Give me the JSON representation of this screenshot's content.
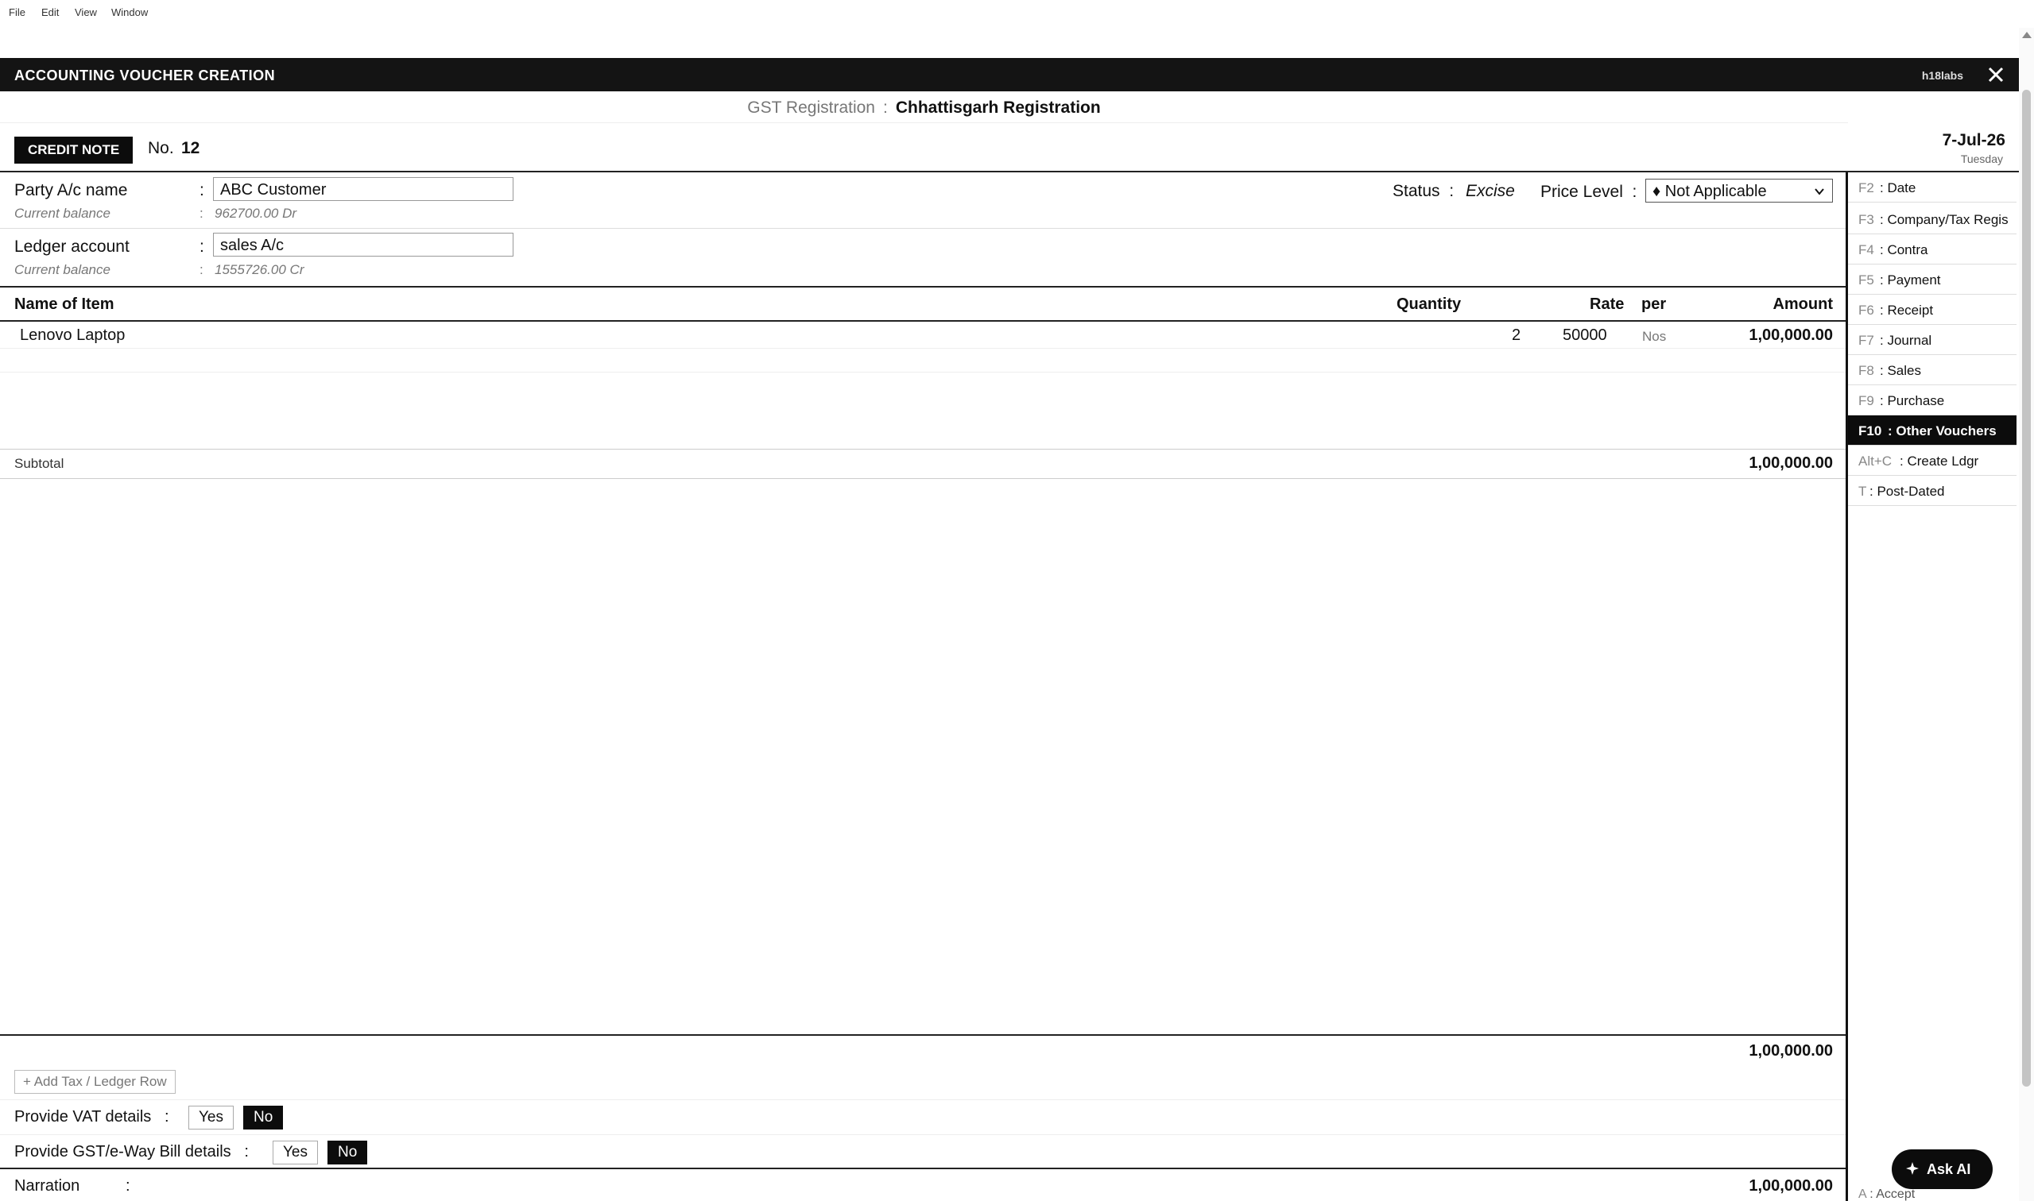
{
  "menu": [
    "File",
    "Edit",
    "View",
    "Window"
  ],
  "window": {
    "title": "ACCOUNTING VOUCHER CREATION",
    "brand": "h18labs"
  },
  "gst": {
    "label": "GST Registration",
    "value": "Chhattisgarh Registration"
  },
  "voucher": {
    "type": "CREDIT NOTE",
    "no_label": "No.",
    "number": "12",
    "date": "7-Jul-26",
    "day": "Tuesday"
  },
  "party": {
    "label": "Party A/c name",
    "value": "ABC Customer",
    "balance_label": "Current balance",
    "balance": "962700.00 Dr"
  },
  "ledger": {
    "label": "Ledger account",
    "value": "sales A/c",
    "balance_label": "Current balance",
    "balance": "1555726.00 Cr"
  },
  "status": {
    "label": "Status",
    "value": "Excise"
  },
  "price_level": {
    "label": "Price Level",
    "selected": "♦ Not Applicable"
  },
  "table": {
    "headers": {
      "name": "Name of Item",
      "quantity": "Quantity",
      "rate": "Rate",
      "per": "per",
      "amount": "Amount"
    },
    "rows": [
      {
        "name": "Lenovo Laptop",
        "quantity": "2",
        "rate": "50000",
        "per": "Nos",
        "amount": "1,00,000.00"
      }
    ]
  },
  "subtotal": {
    "label": "Subtotal",
    "value": "1,00,000.00"
  },
  "total": "1,00,000.00",
  "add_row_label": "+ Add Tax / Ledger Row",
  "vat": {
    "label": "Provide VAT details",
    "yes": "Yes",
    "no": "No"
  },
  "gst_eway": {
    "label": "Provide GST/e-Way Bill details",
    "yes": "Yes",
    "no": "No"
  },
  "narration": {
    "label": "Narration",
    "total": "1,00,000.00"
  },
  "shortcuts": [
    {
      "key": "F2",
      "label": ": Date"
    },
    {
      "key": "F3",
      "label": ": Company/Tax Regis"
    },
    {
      "key": "F4",
      "label": ": Contra"
    },
    {
      "key": "F5",
      "label": ": Payment"
    },
    {
      "key": "F6",
      "label": ": Receipt"
    },
    {
      "key": "F7",
      "label": ": Journal"
    },
    {
      "key": "F8",
      "label": ": Sales"
    },
    {
      "key": "F9",
      "label": ": Purchase"
    },
    {
      "key": "F10",
      "label": ": Other Vouchers"
    },
    {
      "key": "Alt+C",
      "label": ": Create Ldgr"
    },
    {
      "key": "T",
      "label": ": Post-Dated"
    }
  ],
  "ask_ai": "Ask AI",
  "accept": {
    "key": "A",
    "label": ": Accept"
  },
  "colors": {
    "dark": "#0c0c0c",
    "muted": "#777777",
    "border": "#222222"
  }
}
